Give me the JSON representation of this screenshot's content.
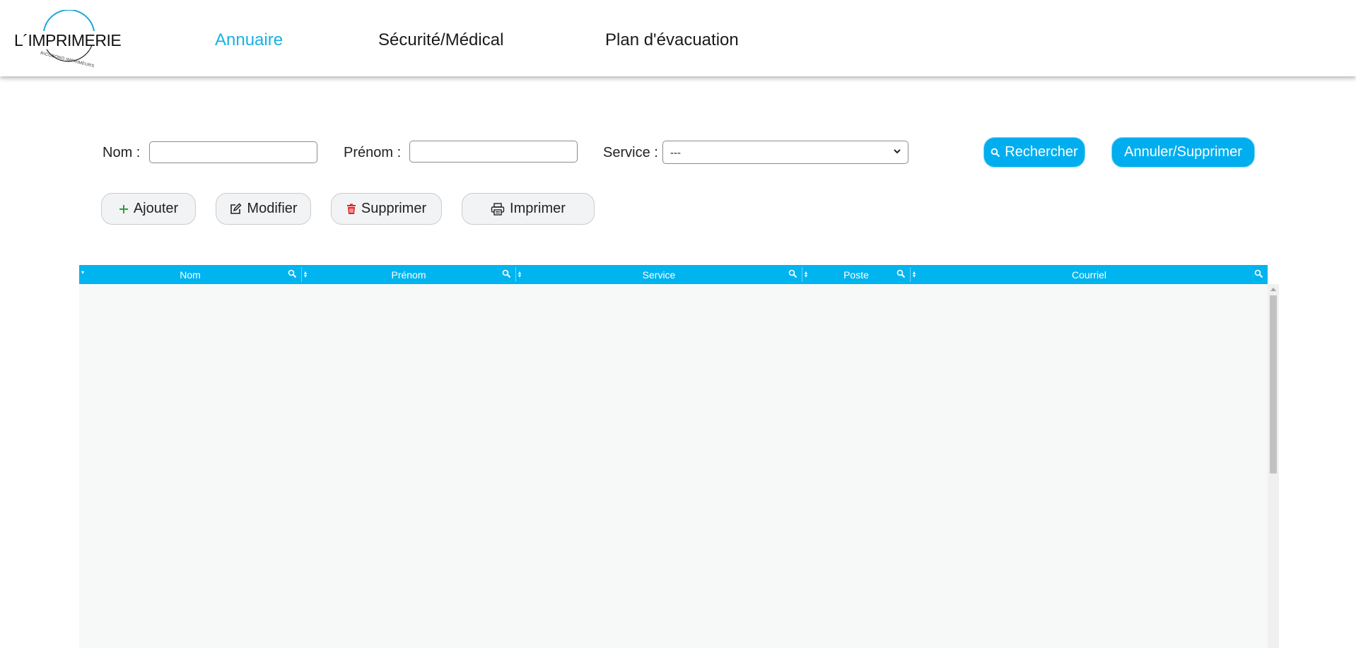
{
  "header": {
    "logo": {
      "main": "L´IMPRIMERIE",
      "sub": "RICOBONO IMPRIMEURS"
    },
    "nav": [
      {
        "label": "Annuaire",
        "active": true
      },
      {
        "label": "Sécurité/Médical",
        "active": false
      },
      {
        "label": "Plan d'évacuation",
        "active": false
      }
    ]
  },
  "filters": {
    "nom_label": "Nom :",
    "nom_value": "",
    "prenom_label": "Prénom :",
    "prenom_value": "",
    "service_label": "Service :",
    "service_selected": "---",
    "search_button": "Rechercher",
    "reset_button": "Annuler/Supprimer"
  },
  "actions": {
    "add": "Ajouter",
    "edit": "Modifier",
    "delete": "Supprimer",
    "print": "Imprimer"
  },
  "table": {
    "columns": [
      "Nom",
      "Prénom",
      "Service",
      "Poste",
      "Courriel"
    ],
    "rows": []
  },
  "colors": {
    "accent": "#00aeef",
    "nav_active": "#1ab0e6",
    "add_icon": "#2e9e3c",
    "delete_icon": "#e02424"
  },
  "icons": {
    "search": "magnifier-icon",
    "add": "plus-icon",
    "edit": "edit-icon",
    "delete": "trash-icon",
    "print": "printer-icon"
  }
}
